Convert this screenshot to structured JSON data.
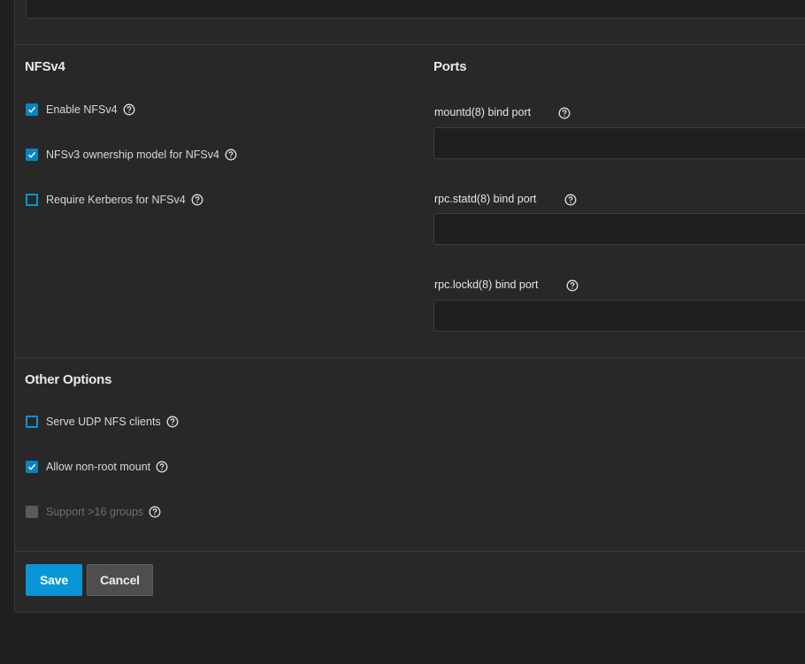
{
  "nfsv4": {
    "title": "NFSv4",
    "options": [
      {
        "label": "Enable NFSv4",
        "checked": true
      },
      {
        "label": "NFSv3 ownership model for NFSv4",
        "checked": true
      },
      {
        "label": "Require Kerberos for NFSv4",
        "checked": false
      }
    ]
  },
  "ports": {
    "title": "Ports",
    "fields": [
      {
        "label": "mountd(8) bind port",
        "value": ""
      },
      {
        "label": "rpc.statd(8) bind port",
        "value": ""
      },
      {
        "label": "rpc.lockd(8) bind port",
        "value": ""
      }
    ]
  },
  "other": {
    "title": "Other Options",
    "options": [
      {
        "label": "Serve UDP NFS clients",
        "checked": false
      },
      {
        "label": "Allow non-root mount",
        "checked": true
      },
      {
        "label": "Support >16 groups",
        "checked": false,
        "disabled": true
      }
    ]
  },
  "actions": {
    "save_label": "Save",
    "cancel_label": "Cancel"
  },
  "colors": {
    "accent": "#0a95d6",
    "background": "#282828"
  },
  "icons": {
    "help": "help-circle-icon",
    "check": "check-icon"
  }
}
